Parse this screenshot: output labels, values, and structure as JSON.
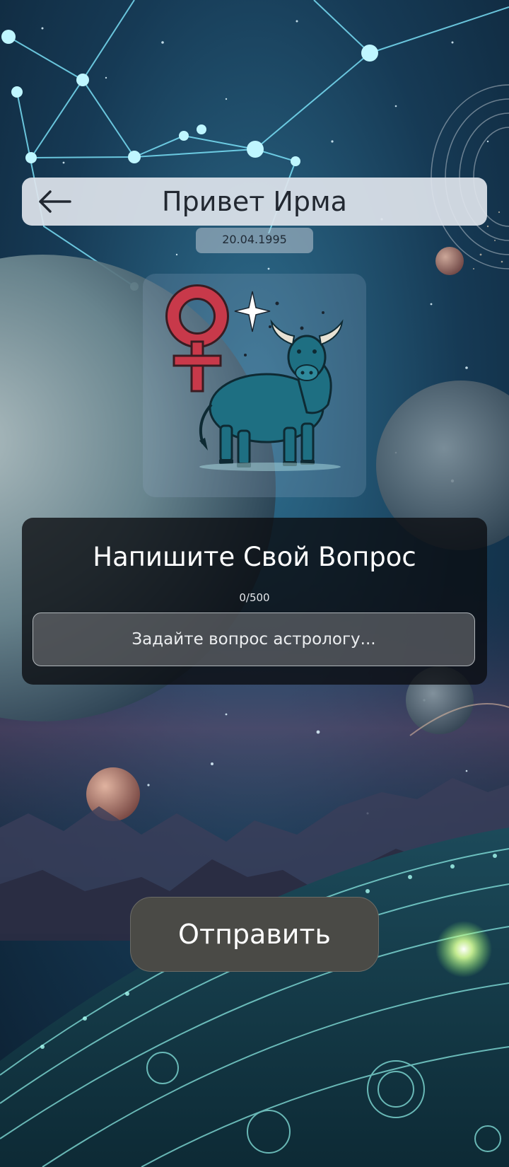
{
  "header": {
    "title": "Привет Ирма",
    "back_icon": "arrow-left-icon"
  },
  "profile": {
    "birth_date": "20.04.1995",
    "zodiac_icon": "taurus-bull-female-icon"
  },
  "question": {
    "title": "Напишите Свой Вопрос",
    "counter": "0/500",
    "value": "",
    "placeholder": "Задайте вопрос астрологу..."
  },
  "actions": {
    "send_label": "Отправить"
  },
  "colors": {
    "header_bg": "#DEE4EC",
    "panel_bg": "#0A0C10",
    "button_bg": "#4A4A46",
    "venus_red": "#C8394A",
    "bull_teal": "#1E6F82",
    "glow_cyan": "#7FE9FF"
  }
}
